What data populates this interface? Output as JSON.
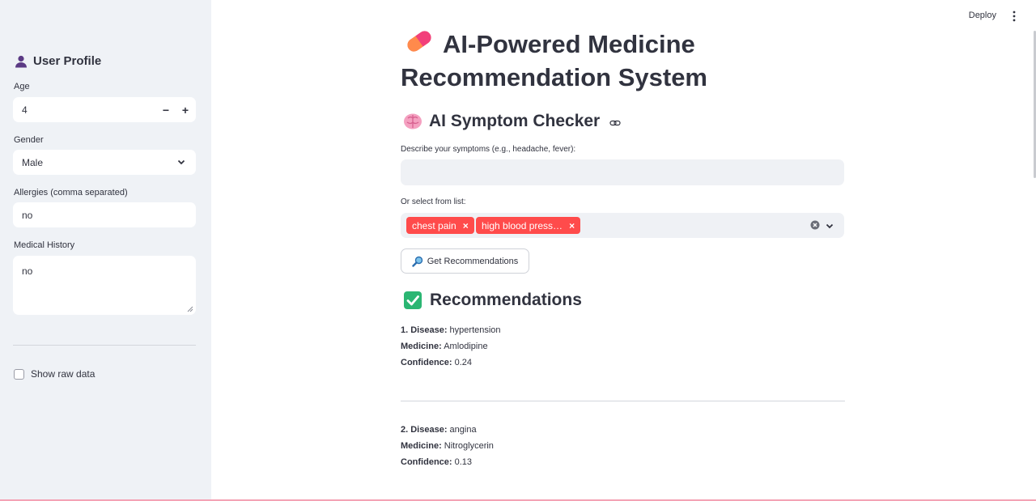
{
  "header": {
    "deploy_label": "Deploy",
    "menu_icon": "vertical-dots-icon"
  },
  "sidebar": {
    "title": "User Profile",
    "title_icon": "user-silhouette-icon",
    "age": {
      "label": "Age",
      "value": "4",
      "minus": "−",
      "plus": "+"
    },
    "gender": {
      "label": "Gender",
      "value": "Male"
    },
    "allergies": {
      "label": "Allergies (comma separated)",
      "value": "no"
    },
    "medical_history": {
      "label": "Medical History",
      "value": "no"
    },
    "show_raw_data": {
      "label": "Show raw data",
      "checked": false
    }
  },
  "main": {
    "title_line1": "AI-Powered Medicine",
    "title_line2": "Recommendation System",
    "title_icon": "pill-icon",
    "symptom_checker": {
      "heading": "AI Symptom Checker",
      "heading_icon": "brain-icon",
      "describe_label": "Describe your symptoms (e.g., headache, fever):",
      "describe_value": "",
      "select_label": "Or select from list:",
      "selected_tags": [
        {
          "label": "chest pain",
          "remove": "×"
        },
        {
          "label": "high blood press…",
          "remove": "×"
        }
      ],
      "button_label": "Get Recommendations",
      "button_icon": "magnifier-icon"
    },
    "recommendations": {
      "heading": "Recommendations",
      "heading_icon": "check-box-icon",
      "items": [
        {
          "disease_key": "1. Disease:",
          "disease": "hypertension",
          "medicine_key": "Medicine:",
          "medicine": "Amlodipine",
          "confidence_key": "Confidence:",
          "confidence": "0.24"
        },
        {
          "disease_key": "2. Disease:",
          "disease": "angina",
          "medicine_key": "Medicine:",
          "medicine": "Nitroglycerin",
          "confidence_key": "Confidence:",
          "confidence": "0.13"
        }
      ]
    }
  },
  "colors": {
    "sidebar_bg": "#eff2f6",
    "tag_bg": "#ff4b4b",
    "check_green": "#2bb673",
    "text": "#31333f"
  }
}
